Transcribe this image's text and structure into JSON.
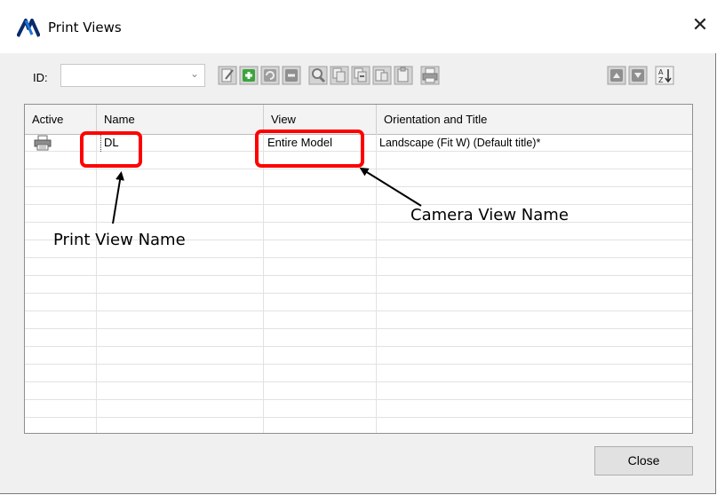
{
  "window": {
    "title": "Print Views",
    "close_glyph": "✕"
  },
  "toolbar": {
    "id_label": "ID:",
    "id_value": "",
    "buttons": [
      "edit-icon",
      "add-icon",
      "refresh-icon",
      "remove-icon",
      "zoom-icon",
      "copy-icon",
      "copy-next-icon",
      "copy-prev-icon",
      "paste-icon",
      "print-icon",
      "move-up-icon",
      "move-down-icon",
      "sort-az-icon"
    ]
  },
  "table": {
    "columns": [
      "Active",
      "Name",
      "View",
      "Orientation and Title"
    ],
    "rows": [
      {
        "active": "printer-icon",
        "name": "DL",
        "view": "Entire Model",
        "orientation": "Landscape (Fit W) (Default title)*"
      }
    ]
  },
  "close_label": "Close",
  "annotations": {
    "print_view_name": "Print View Name",
    "camera_view_name": "Camera View Name",
    "callout_color": "#ff0000"
  }
}
